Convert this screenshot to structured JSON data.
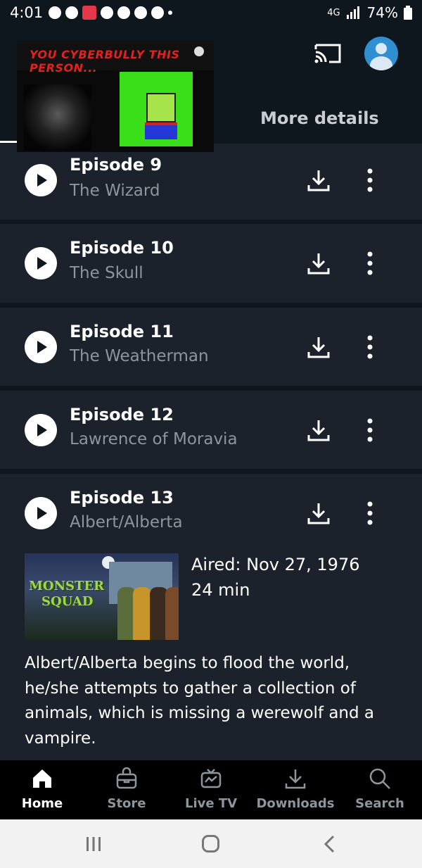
{
  "status_bar": {
    "time": "4:01",
    "battery": "74%",
    "network": "4G"
  },
  "header": {
    "more_details_tab": "More details"
  },
  "overlay": {
    "banner_text": "YOU CYBERBULLY THIS PERSON..."
  },
  "episodes": [
    {
      "title": "Episode 9",
      "name": "The Wizard"
    },
    {
      "title": "Episode 10",
      "name": "The Skull"
    },
    {
      "title": "Episode 11",
      "name": "The Weatherman"
    },
    {
      "title": "Episode 12",
      "name": "Lawrence of Moravia"
    },
    {
      "title": "Episode 13",
      "name": "Albert/Alberta"
    }
  ],
  "expanded_episode": {
    "thumbnail_logo_line1": "MONSTER",
    "thumbnail_logo_line2": "SQUAD",
    "aired": "Aired: Nov 27, 1976",
    "duration": "24 min",
    "synopsis": "Albert/Alberta begins to flood the world, he/she attempts to gather a collection of animals, which is missing a werewolf and a vampire."
  },
  "bottom_nav": [
    {
      "label": "Home",
      "icon": "home-icon",
      "active": true
    },
    {
      "label": "Store",
      "icon": "store-icon",
      "active": false
    },
    {
      "label": "Live TV",
      "icon": "live-tv-icon",
      "active": false
    },
    {
      "label": "Downloads",
      "icon": "downloads-icon",
      "active": false
    },
    {
      "label": "Search",
      "icon": "search-icon",
      "active": false
    }
  ]
}
